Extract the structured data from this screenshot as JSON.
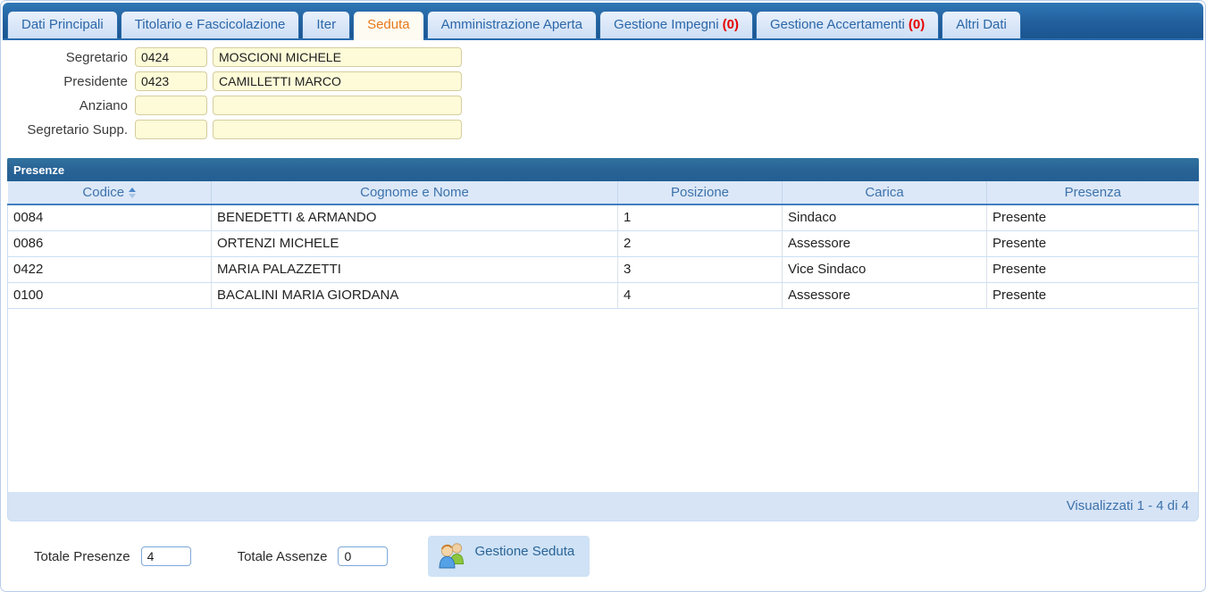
{
  "colors": {
    "tab_bar_blue": "#225f9c",
    "active_tab_text": "#e8781a",
    "badge_red": "#e60000",
    "field_yellow": "#fdfbd8",
    "grid_header_blue": "#dce8f8",
    "grid_title_blue": "#2a6496",
    "footer_blue": "#d7e4f6"
  },
  "tabs": [
    {
      "label": "Dati Principali"
    },
    {
      "label": "Titolario e Fascicolazione"
    },
    {
      "label": "Iter"
    },
    {
      "label": "Seduta",
      "active": true
    },
    {
      "label": "Amministrazione Aperta"
    },
    {
      "label": "Gestione Impegni",
      "badge": "(0)"
    },
    {
      "label": "Gestione Accertamenti",
      "badge": "(0)"
    },
    {
      "label": "Altri Dati"
    }
  ],
  "form": {
    "fields": [
      {
        "label": "Segretario",
        "code": "0424",
        "name": "MOSCIONI MICHELE"
      },
      {
        "label": "Presidente",
        "code": "0423",
        "name": "CAMILLETTI MARCO"
      },
      {
        "label": "Anziano",
        "code": "",
        "name": ""
      },
      {
        "label": "Segretario Supp.",
        "code": "",
        "name": ""
      }
    ]
  },
  "presenze": {
    "title": "Presenze",
    "columns": [
      "Codice",
      "Cognome e Nome",
      "Posizione",
      "Carica",
      "Presenza"
    ],
    "rows": [
      [
        "0084",
        "BENEDETTI & ARMANDO",
        "1",
        "Sindaco",
        "Presente"
      ],
      [
        "0086",
        "ORTENZI MICHELE",
        "2",
        "Assessore",
        "Presente"
      ],
      [
        "0422",
        "MARIA PALAZZETTI",
        "3",
        "Vice Sindaco",
        "Presente"
      ],
      [
        "0100",
        "BACALINI MARIA GIORDANA",
        "4",
        "Assessore",
        "Presente"
      ]
    ],
    "footer_text": "Visualizzati 1 - 4 di 4"
  },
  "totals": {
    "presenze_label": "Totale Presenze",
    "presenze_value": "4",
    "assenze_label": "Totale Assenze",
    "assenze_value": "0",
    "button_label": "Gestione Seduta"
  }
}
